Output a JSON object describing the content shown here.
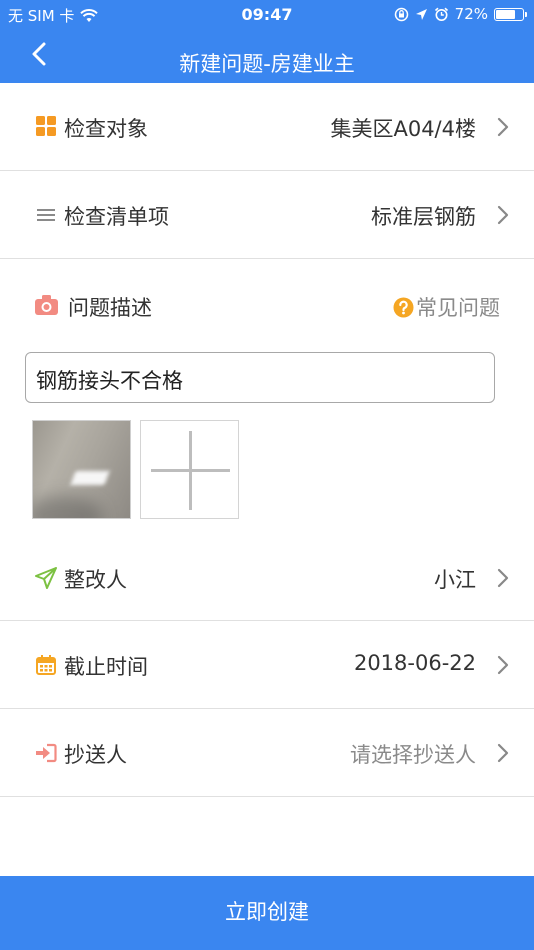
{
  "status_bar": {
    "carrier": "无 SIM 卡",
    "time": "09:47",
    "battery_percent": "72%",
    "battery_level": 0.72
  },
  "nav": {
    "title": "新建问题-房建业主"
  },
  "form": {
    "inspection_target": {
      "label": "检查对象",
      "value": "集美区A04/4楼"
    },
    "checklist_item": {
      "label": "检查清单项",
      "value": "标准层钢筋"
    },
    "problem_description": {
      "label": "问题描述",
      "common_issues_link": "常见问题",
      "text": "钢筋接头不合格"
    },
    "rectifier": {
      "label": "整改人",
      "value": "小江"
    },
    "deadline": {
      "label": "截止时间",
      "value": "2018-06-22"
    },
    "cc": {
      "label": "抄送人",
      "placeholder": "请选择抄送人"
    }
  },
  "footer": {
    "create_button": "立即创建"
  },
  "colors": {
    "brand_blue": "#3a86f0",
    "grid_icon_orange": "#f59a23",
    "camera_icon_pink": "#f28b82",
    "help_icon_orange": "#f5a623",
    "send_icon_green": "#7cc142",
    "calendar_icon_orange": "#f5a623",
    "cc_icon_pink": "#f28b82"
  }
}
